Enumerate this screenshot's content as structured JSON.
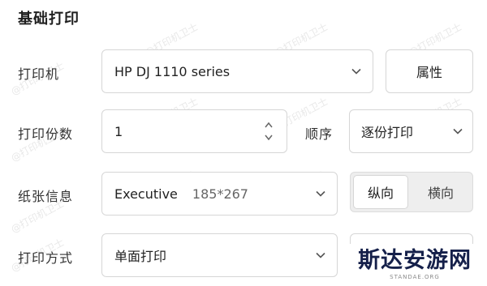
{
  "section_title": "基础打印",
  "printer": {
    "label": "打印机",
    "value": "HP DJ 1110 series",
    "properties_button": "属性"
  },
  "copies": {
    "label": "打印份数",
    "value": "1",
    "order_label": "顺序",
    "order_value": "逐份打印"
  },
  "paper": {
    "label": "纸张信息",
    "size_name": "Executive",
    "size_dims": "185*267",
    "portrait": "纵向",
    "landscape": "横向",
    "selected_orientation": "纵向"
  },
  "print_mode": {
    "label": "打印方式",
    "value": "单面打印"
  },
  "watermark_text": "@打印机卫士",
  "logo": {
    "name": "斯达安游网",
    "domain": "STANDAE.ORG"
  },
  "colors": {
    "border": "#d6d6d6",
    "segment_bg": "#eeeeee",
    "logo_text": "#15204a"
  }
}
